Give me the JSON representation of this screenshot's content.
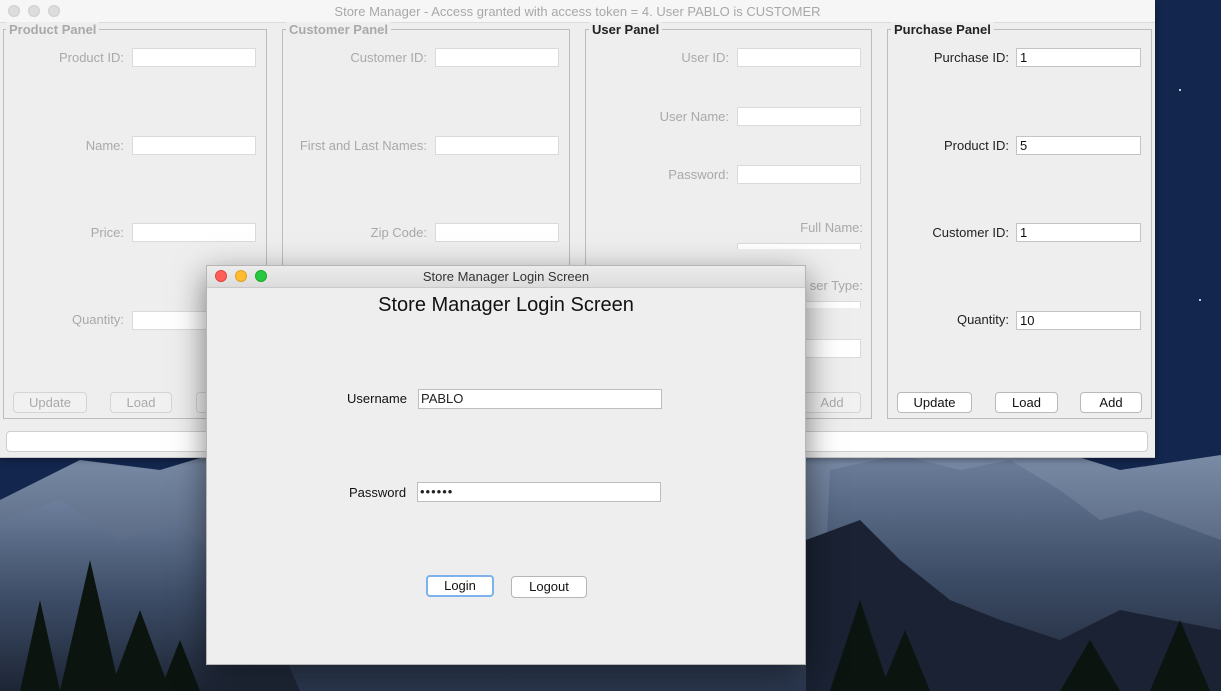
{
  "main_window": {
    "title": "Store Manager - Access granted with access token = 4. User PABLO is CUSTOMER"
  },
  "product_panel": {
    "title": "Product Panel",
    "labels": {
      "product_id": "Product ID:",
      "name": "Name:",
      "price": "Price:",
      "quantity": "Quantity:"
    },
    "values": {
      "product_id": "",
      "name": "",
      "price": "",
      "quantity": ""
    },
    "buttons": {
      "update": "Update",
      "load": "Load"
    }
  },
  "customer_panel": {
    "title": "Customer Panel",
    "labels": {
      "customer_id": "Customer ID:",
      "names": "First and Last Names:",
      "zip": "Zip Code:"
    },
    "values": {
      "customer_id": "",
      "names": "",
      "zip": ""
    }
  },
  "user_panel": {
    "title": "User Panel",
    "labels": {
      "user_id": "User ID:",
      "user_name": "User Name:",
      "password": "Password:",
      "full_name": "Full Name:",
      "user_type_partial": "ser Type:"
    },
    "values": {
      "user_id": "",
      "user_name": "",
      "password": ""
    },
    "buttons": {
      "add": "Add"
    }
  },
  "purchase_panel": {
    "title": "Purchase Panel",
    "labels": {
      "purchase_id": "Purchase ID:",
      "product_id": "Product ID:",
      "customer_id": "Customer ID:",
      "quantity": "Quantity:"
    },
    "values": {
      "purchase_id": "1",
      "product_id": "5",
      "customer_id": "1",
      "quantity": "10"
    },
    "buttons": {
      "update": "Update",
      "load": "Load",
      "add": "Add"
    }
  },
  "login_window": {
    "title": "Store Manager Login Screen",
    "heading": "Store Manager Login Screen",
    "username_label": "Username",
    "username_value": "PABLO",
    "password_label": "Password",
    "password_value": "••••••",
    "login_button": "Login",
    "logout_button": "Logout"
  },
  "colors": {
    "close": "#fe5f57",
    "minimize": "#febc2e",
    "zoom": "#28c840",
    "focus_ring": "#7eb2ee"
  }
}
